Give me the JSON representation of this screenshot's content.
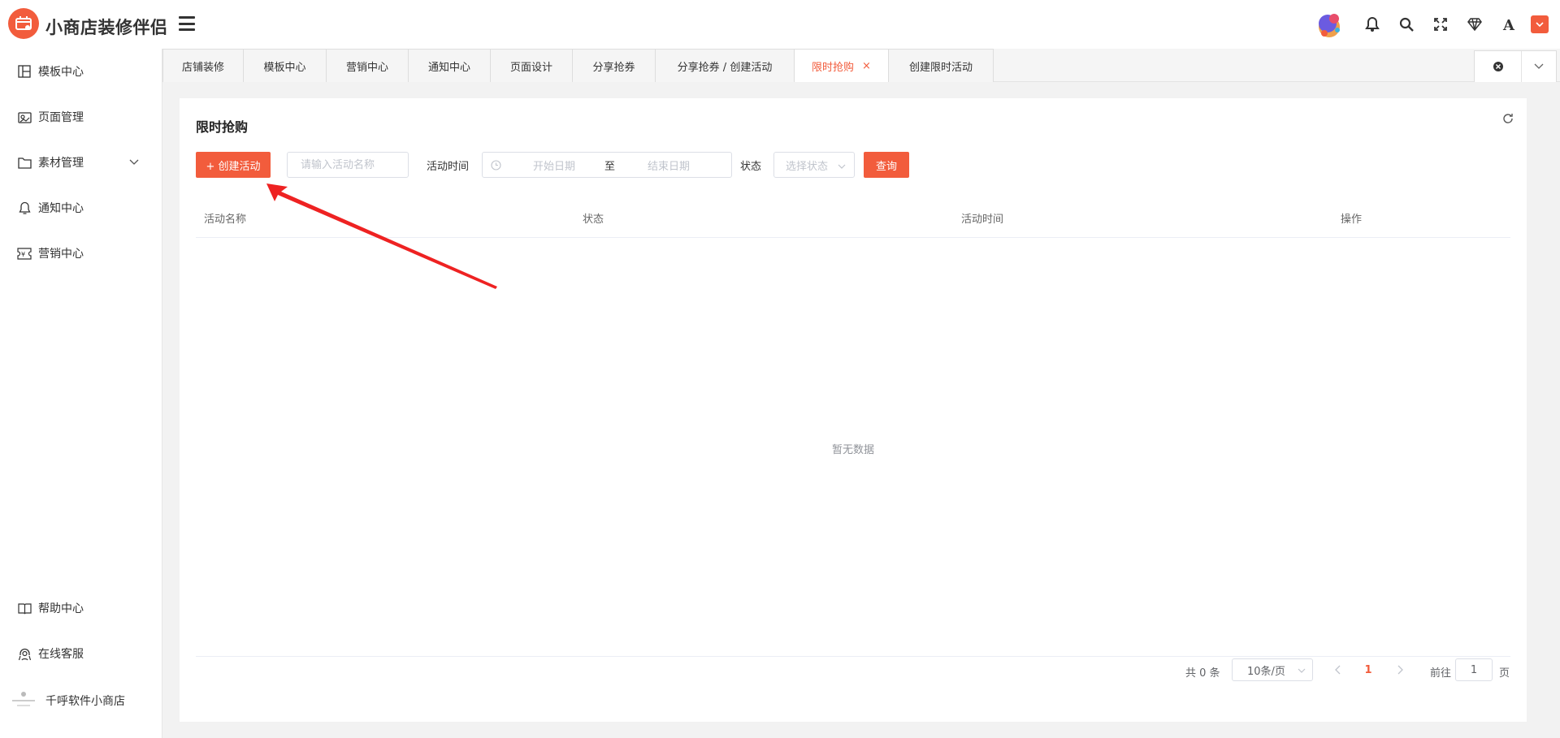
{
  "brand": {
    "title": "小商店装修伴侣",
    "accent": "#f25c3c"
  },
  "header": {
    "icons": [
      "mascot-icon",
      "bell-icon",
      "search-icon",
      "fullscreen-icon",
      "diamond-icon",
      "font-icon",
      "user-menu-icon"
    ]
  },
  "sidebar": {
    "items": [
      {
        "label": "模板中心",
        "icon": "template-icon"
      },
      {
        "label": "页面管理",
        "icon": "page-icon"
      },
      {
        "label": "素材管理",
        "icon": "folder-icon",
        "expandable": true
      },
      {
        "label": "通知中心",
        "icon": "bell-icon"
      },
      {
        "label": "营销中心",
        "icon": "coupon-icon"
      }
    ],
    "bottom": [
      {
        "label": "帮助中心",
        "icon": "book-icon"
      },
      {
        "label": "在线客服",
        "icon": "headset-icon"
      }
    ],
    "store": {
      "name": "千呼软件小商店"
    }
  },
  "tabs": [
    {
      "label": "店铺装修"
    },
    {
      "label": "模板中心"
    },
    {
      "label": "营销中心"
    },
    {
      "label": "通知中心"
    },
    {
      "label": "页面设计"
    },
    {
      "label": "分享抢券"
    },
    {
      "label": "分享抢券 / 创建活动"
    },
    {
      "label": "限时抢购",
      "active": true,
      "close": "×"
    },
    {
      "label": "创建限时活动"
    }
  ],
  "page": {
    "title": "限时抢购",
    "create_button": "+ 创建活动",
    "search_placeholder": "请输入活动名称",
    "time_label": "活动时间",
    "start_placeholder": "开始日期",
    "range_sep": "至",
    "end_placeholder": "结束日期",
    "state_label": "状态",
    "state_placeholder": "选择状态",
    "query_button": "查询"
  },
  "table": {
    "columns": [
      "活动名称",
      "状态",
      "活动时间",
      "操作"
    ],
    "empty_text": "暂无数据"
  },
  "pagination": {
    "total_text": "共 0 条",
    "page_size": "10条/页",
    "current_page": "1",
    "goto_label": "前往",
    "goto_value": "1",
    "page_suffix": "页"
  }
}
